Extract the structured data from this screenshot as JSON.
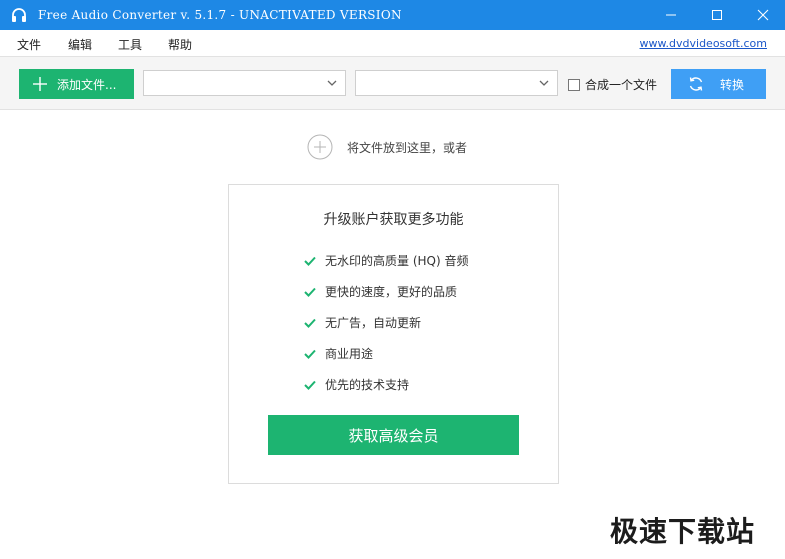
{
  "window": {
    "title": "Free Audio Converter v. 5.1.7 - UNACTIVATED VERSION",
    "icons": [
      "headphones-icon",
      "minimize-icon",
      "maximize-icon",
      "close-icon"
    ]
  },
  "menu": {
    "items": [
      {
        "label": "文件"
      },
      {
        "label": "编辑"
      },
      {
        "label": "工具"
      },
      {
        "label": "帮助"
      }
    ],
    "website": "www.dvdvideosoft.com"
  },
  "toolbar": {
    "add_label": "添加文件...",
    "format_select": "",
    "preset_select": "",
    "merge_label": "合成一个文件",
    "merge_checked": false,
    "convert_label": "转换"
  },
  "drop": {
    "hint": "将文件放到这里，或者"
  },
  "upgrade": {
    "title": "升级账户获取更多功能",
    "features": [
      "无水印的高质量 (HQ) 音频",
      "更快的速度，更好的品质",
      "无广告，自动更新",
      "商业用途",
      "优先的技术支持"
    ],
    "button_label": "获取高级会员"
  },
  "watermark": "极速下载站",
  "colors": {
    "titlebar": "#1e88e5",
    "green": "#1db471",
    "blue_button": "#3f9ff5",
    "link": "#1a56c8"
  }
}
